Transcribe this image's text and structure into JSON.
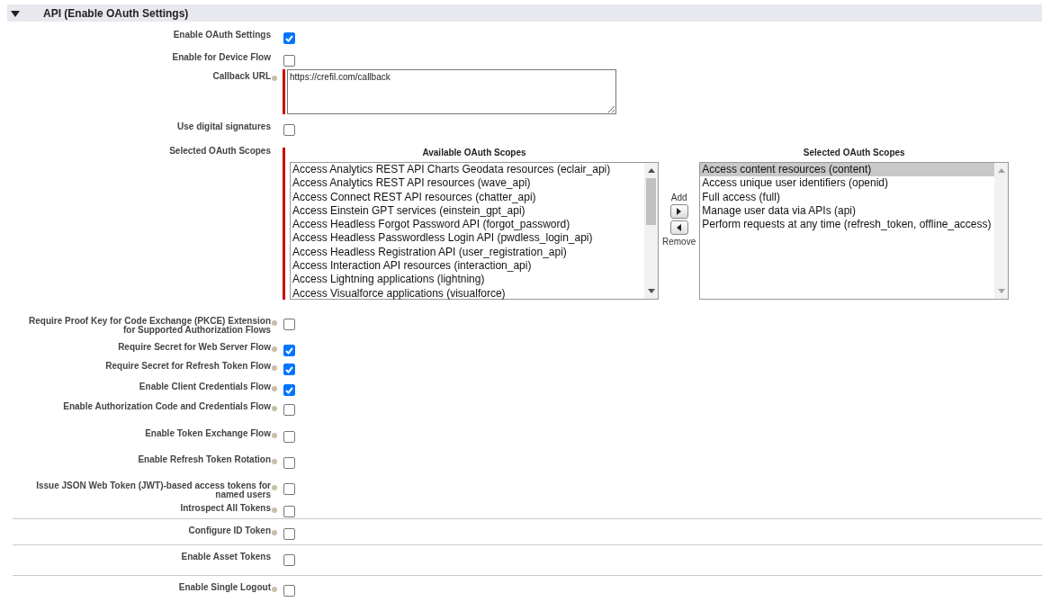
{
  "section": {
    "title": "API (Enable OAuth Settings)",
    "expanded": true
  },
  "rows": [
    {
      "kind": "checkbox",
      "label": "Enable OAuth Settings",
      "help": false,
      "checked": true,
      "divider_above": false
    },
    {
      "kind": "checkbox",
      "label": "Enable for Device Flow",
      "help": false,
      "checked": false,
      "divider_above": false
    },
    {
      "kind": "textarea",
      "label": "Callback URL",
      "help": true,
      "required": true,
      "value": "https://crefil.com/callback",
      "divider_above": false
    },
    {
      "kind": "checkbox",
      "label": "Use digital signatures",
      "help": false,
      "checked": false,
      "divider_above": false
    },
    {
      "kind": "scopes",
      "label": "Selected OAuth Scopes",
      "help": false,
      "required": true,
      "divider_above": false,
      "available": {
        "title": "Available OAuth Scopes",
        "items": [
          {
            "label": "Access Analytics REST API Charts Geodata resources (eclair_api)",
            "selected": false
          },
          {
            "label": "Access Analytics REST API resources (wave_api)",
            "selected": false
          },
          {
            "label": "Access Connect REST API resources (chatter_api)",
            "selected": false
          },
          {
            "label": "Access Einstein GPT services (einstein_gpt_api)",
            "selected": false
          },
          {
            "label": "Access Headless Forgot Password API (forgot_password)",
            "selected": false
          },
          {
            "label": "Access Headless Passwordless Login API (pwdless_login_api)",
            "selected": false
          },
          {
            "label": "Access Headless Registration API (user_registration_api)",
            "selected": false
          },
          {
            "label": "Access Interaction API resources (interaction_api)",
            "selected": false
          },
          {
            "label": "Access Lightning applications (lightning)",
            "selected": false
          },
          {
            "label": "Access Visualforce applications (visualforce)",
            "selected": false
          }
        ]
      },
      "add_label": "Add",
      "remove_label": "Remove",
      "selected": {
        "title": "Selected OAuth Scopes",
        "items": [
          {
            "label": "Access content resources (content)",
            "selected": true
          },
          {
            "label": "Access unique user identifiers (openid)",
            "selected": false
          },
          {
            "label": "Full access (full)",
            "selected": false
          },
          {
            "label": "Manage user data via APIs (api)",
            "selected": false
          },
          {
            "label": "Perform requests at any time (refresh_token, offline_access)",
            "selected": false
          }
        ]
      }
    },
    {
      "kind": "checkbox",
      "label": "Require Proof Key for Code Exchange (PKCE) Extension for Supported Authorization Flows",
      "help": true,
      "checked": false,
      "divider_above": false
    },
    {
      "kind": "checkbox",
      "label": "Require Secret for Web Server Flow",
      "help": true,
      "checked": true,
      "divider_above": false
    },
    {
      "kind": "checkbox",
      "label": "Require Secret for Refresh Token Flow",
      "help": true,
      "checked": true,
      "divider_above": false
    },
    {
      "kind": "checkbox",
      "label": "Enable Client Credentials Flow",
      "help": true,
      "checked": true,
      "divider_above": false
    },
    {
      "kind": "checkbox",
      "label": "Enable Authorization Code and Credentials Flow",
      "help": true,
      "checked": false,
      "divider_above": false
    },
    {
      "kind": "checkbox",
      "label": "Enable Token Exchange Flow",
      "help": true,
      "checked": false,
      "divider_above": false
    },
    {
      "kind": "checkbox",
      "label": "Enable Refresh Token Rotation",
      "help": true,
      "checked": false,
      "divider_above": false
    },
    {
      "kind": "checkbox",
      "label": "Issue JSON Web Token (JWT)-based access tokens for named users",
      "help": true,
      "checked": false,
      "divider_above": false
    },
    {
      "kind": "checkbox",
      "label": "Introspect All Tokens",
      "help": true,
      "checked": false,
      "divider_above": false
    },
    {
      "kind": "checkbox",
      "label": "Configure ID Token",
      "help": true,
      "checked": false,
      "divider_above": true
    },
    {
      "kind": "checkbox",
      "label": "Enable Asset Tokens",
      "help": false,
      "checked": false,
      "divider_above": true
    },
    {
      "kind": "checkbox",
      "label": "Enable Single Logout",
      "help": true,
      "checked": false,
      "divider_above": true
    }
  ]
}
